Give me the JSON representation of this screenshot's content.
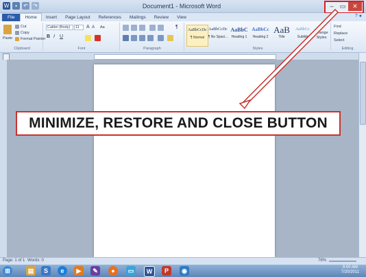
{
  "window": {
    "title": "Document1 - Microsoft Word",
    "controls": [
      "–",
      "▭",
      "✕"
    ]
  },
  "tabs": [
    "File",
    "Home",
    "Insert",
    "Page Layout",
    "References",
    "Mailings",
    "Review",
    "View"
  ],
  "clipboard": {
    "paste": "Paste",
    "cut": "Cut",
    "copy": "Copy",
    "format_painter": "Format Painter",
    "label": "Clipboard"
  },
  "font": {
    "name": "Calibri (Body)",
    "size": "11",
    "label": "Font",
    "bold": "B",
    "italic": "I",
    "underline": "U",
    "grow": "A",
    "shrink": "A",
    "clear": "Aa"
  },
  "paragraph": {
    "label": "Paragraph",
    "pilcrow": "¶"
  },
  "styles": {
    "label": "Styles",
    "items": [
      {
        "sample": "AaBbCcDc",
        "name": "¶ Normal"
      },
      {
        "sample": "AaBbCcDc",
        "name": "¶ No Spaci..."
      },
      {
        "sample": "AaBbC",
        "name": "Heading 1"
      },
      {
        "sample": "AaBbCc",
        "name": "Heading 2"
      },
      {
        "sample": "AaB",
        "name": "Title"
      },
      {
        "sample": "AaBbCc.",
        "name": "Subtitle"
      }
    ],
    "change_styles": "Change Styles"
  },
  "editing": {
    "label": "Editing",
    "find": "Find",
    "replace": "Replace",
    "select": "Select"
  },
  "callout": "MINIMIZE, RESTORE AND CLOSE BUTTON",
  "status": {
    "page": "Page: 1 of 1",
    "words": "Words: 0",
    "zoom": "78%"
  },
  "clock": {
    "time": "9:00 AM",
    "date": "7/20/2011"
  },
  "colors": {
    "accent": "#2a5caa",
    "callout_border": "#c7332e"
  }
}
